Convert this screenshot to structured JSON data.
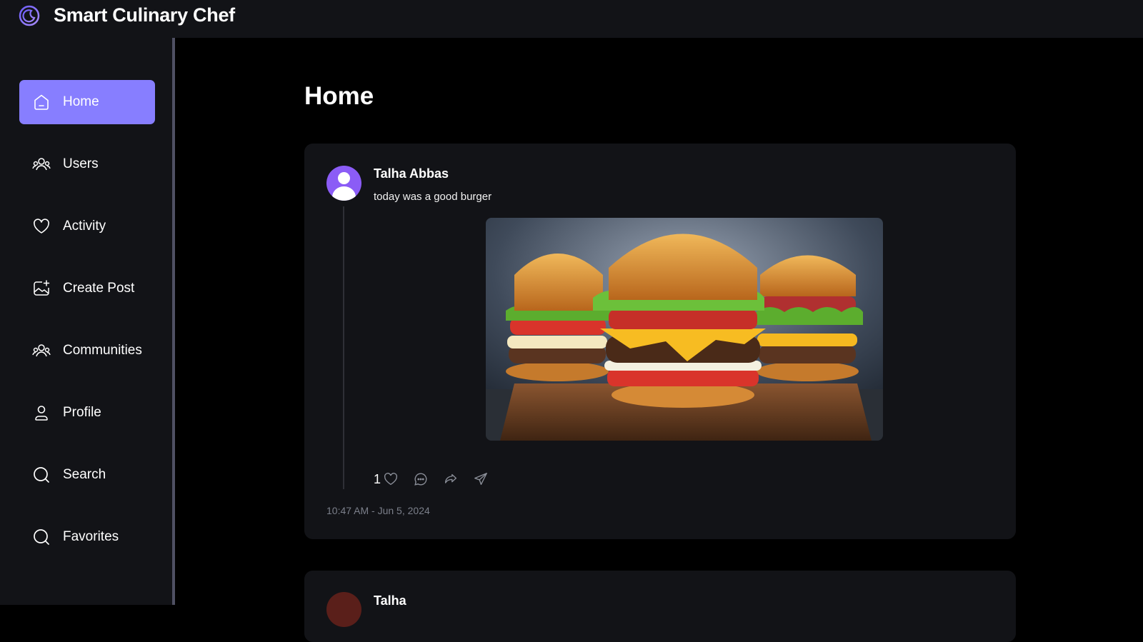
{
  "app": {
    "title": "Smart Culinary Chef",
    "logo_icon": "crescent-logo-icon"
  },
  "sidebar": {
    "items": [
      {
        "label": "Home",
        "icon": "home-icon",
        "active": true
      },
      {
        "label": "Users",
        "icon": "users-icon",
        "active": false
      },
      {
        "label": "Activity",
        "icon": "heart-icon",
        "active": false
      },
      {
        "label": "Create Post",
        "icon": "image-plus-icon",
        "active": false
      },
      {
        "label": "Communities",
        "icon": "communities-icon",
        "active": false
      },
      {
        "label": "Profile",
        "icon": "user-icon",
        "active": false
      },
      {
        "label": "Search",
        "icon": "search-icon",
        "active": false
      },
      {
        "label": "Favorites",
        "icon": "search-icon",
        "active": false
      }
    ]
  },
  "main": {
    "title": "Home",
    "posts": [
      {
        "author": "Talha Abbas",
        "text": "today was a good burger",
        "image": "burger-photo",
        "likes": "1",
        "timestamp": "10:47 AM - Jun 5, 2024"
      },
      {
        "author": "Talha"
      }
    ]
  },
  "colors": {
    "accent": "#877eff",
    "background": "#000000",
    "panel": "#121317"
  }
}
